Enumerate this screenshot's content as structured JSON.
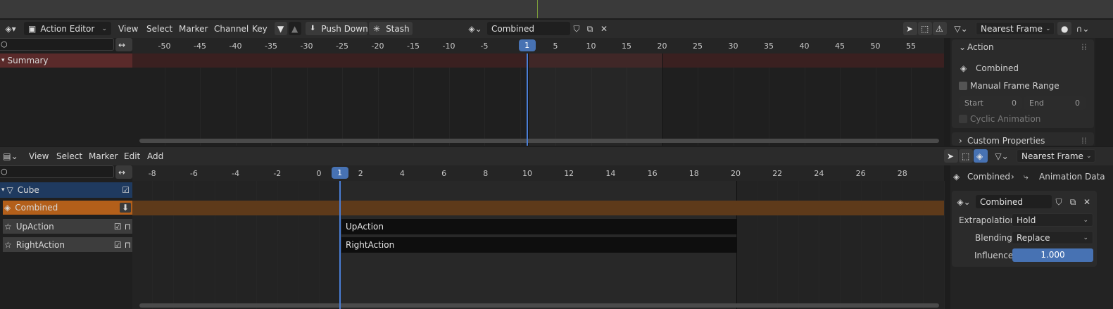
{
  "top_editor": {
    "editor_type": "Action Editor",
    "menus": [
      "View",
      "Select",
      "Marker",
      "Channel",
      "Key"
    ],
    "push_down_label": "Push Down",
    "stash_label": "Stash",
    "action_name": "Combined",
    "snap_mode": "Nearest Frame",
    "ruler_ticks": [
      "-50",
      "-45",
      "-40",
      "-35",
      "-30",
      "-25",
      "-20",
      "-15",
      "-10",
      "-5",
      "1",
      "5",
      "10",
      "15",
      "20",
      "25",
      "30",
      "35",
      "40",
      "45",
      "50",
      "55"
    ],
    "current_frame": "1",
    "summary_label": "Summary",
    "sidebar": {
      "panel_title": "Action",
      "action_name": "Combined",
      "manual_range_label": "Manual Frame Range",
      "start_label": "Start",
      "start_value": "0",
      "end_label": "End",
      "end_value": "0",
      "cyclic_label": "Cyclic Animation",
      "custom_props_label": "Custom Properties"
    }
  },
  "bottom_editor": {
    "menus": [
      "View",
      "Select",
      "Marker",
      "Edit",
      "Add"
    ],
    "snap_mode": "Nearest Frame",
    "ruler_ticks": [
      "-8",
      "-6",
      "-4",
      "-2",
      "0",
      "1",
      "2",
      "4",
      "6",
      "8",
      "10",
      "12",
      "14",
      "16",
      "18",
      "20",
      "22",
      "24",
      "26",
      "28"
    ],
    "current_frame": "1",
    "channels": [
      {
        "label": "Cube",
        "kind": "object"
      },
      {
        "label": "Combined",
        "kind": "action"
      },
      {
        "label": "UpAction",
        "kind": "track"
      },
      {
        "label": "RightAction",
        "kind": "track"
      }
    ],
    "strips": [
      "UpAction",
      "RightAction"
    ],
    "sidebar": {
      "breadcrumb_object": "Combined",
      "breadcrumb_data": "Animation Data",
      "action_name": "Combined",
      "extrapolation_label": "Extrapolation",
      "extrapolation_value": "Hold",
      "blending_label": "Blending",
      "blending_value": "Replace",
      "influence_label": "Influence",
      "influence_value": "1.000"
    }
  },
  "colors": {
    "accent": "#4772b3",
    "summary_row": "#5a2a2a",
    "action_row": "#b35f1a",
    "object_row": "#1f3a5f"
  }
}
